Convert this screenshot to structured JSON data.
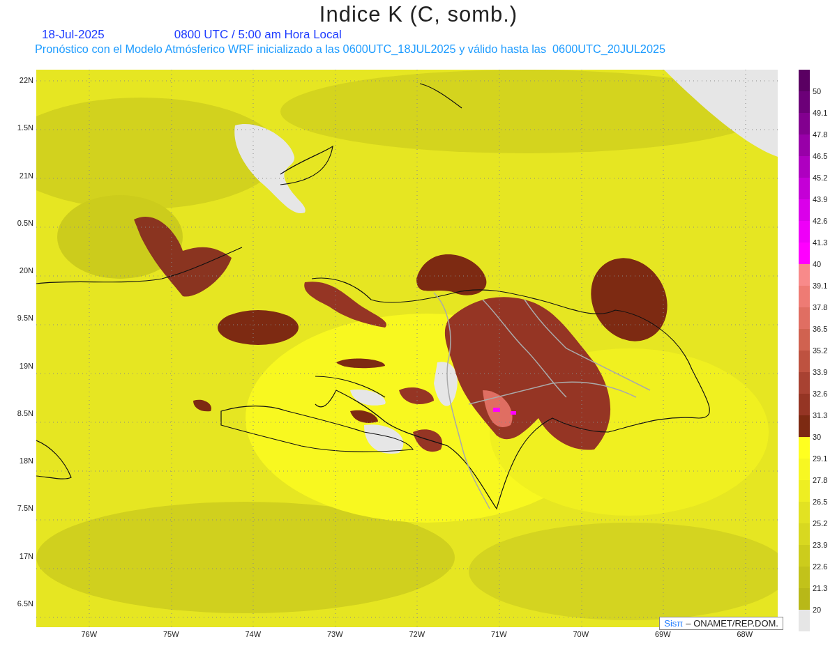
{
  "title": "Indice K (C, somb.)",
  "date": "18-Jul-2025",
  "time": "0800 UTC / 5:00 am Hora Local",
  "subtitle": "Pronóstico con el Modelo Atmósferico WRF inicializado a las 0600UTC_18JUL2025 y válido hasta las  0600UTC_20JUL2025",
  "lat_labels": [
    "22N",
    "1.5N",
    "21N",
    "0.5N",
    "20N",
    "9.5N",
    "19N",
    "8.5N",
    "18N",
    "7.5N",
    "17N",
    "6.5N"
  ],
  "lon_labels": [
    "76W",
    "75W",
    "74W",
    "73W",
    "72W",
    "71W",
    "70W",
    "69W",
    "68W"
  ],
  "credit": {
    "logo": "Sisπ",
    "text": "– ONAMET/REP.DOM."
  },
  "legend": [
    {
      "label": "50",
      "color": "#5a0062"
    },
    {
      "label": "49.1",
      "color": "#6c0078"
    },
    {
      "label": "47.8",
      "color": "#82008f"
    },
    {
      "label": "46.5",
      "color": "#9800a8"
    },
    {
      "label": "45.2",
      "color": "#ae00c0"
    },
    {
      "label": "43.9",
      "color": "#c400d6"
    },
    {
      "label": "42.6",
      "color": "#da00ea"
    },
    {
      "label": "41.3",
      "color": "#ee00f8"
    },
    {
      "label": "40",
      "color": "#ff00ff"
    },
    {
      "label": "39.1",
      "color": "#f88a8a"
    },
    {
      "label": "37.8",
      "color": "#ee7b74"
    },
    {
      "label": "36.5",
      "color": "#e06e62"
    },
    {
      "label": "35.2",
      "color": "#d06250"
    },
    {
      "label": "33.9",
      "color": "#be5240"
    },
    {
      "label": "32.6",
      "color": "#a84232"
    },
    {
      "label": "31.3",
      "color": "#953524"
    },
    {
      "label": "30",
      "color": "#7d2a12"
    },
    {
      "label": "29.1",
      "color": "#ffff20"
    },
    {
      "label": "27.8",
      "color": "#f7f722"
    },
    {
      "label": "26.5",
      "color": "#eeee22"
    },
    {
      "label": "25.2",
      "color": "#e2e222"
    },
    {
      "label": "23.9",
      "color": "#d8d820"
    },
    {
      "label": "22.6",
      "color": "#cccc1c"
    },
    {
      "label": "21.3",
      "color": "#c2c21a"
    },
    {
      "label": "20",
      "color": "#b8b818"
    },
    {
      "color": "#e6e6e6"
    }
  ]
}
